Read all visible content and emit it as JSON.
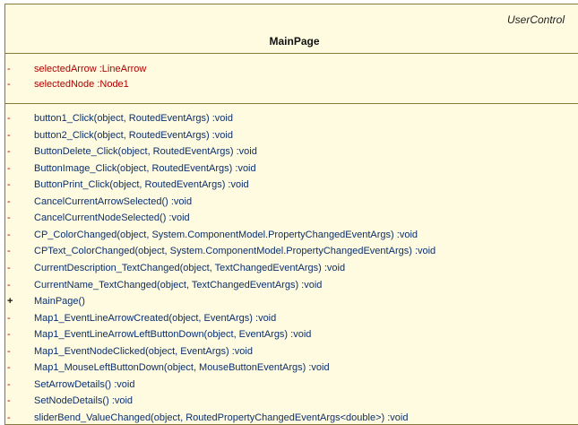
{
  "class": {
    "stereotype": "UserControl",
    "name": "MainPage"
  },
  "attributes": [
    {
      "visibility": "-",
      "text": "selectedArrow :LineArrow"
    },
    {
      "visibility": "-",
      "text": "selectedNode :Node1"
    }
  ],
  "methods": [
    {
      "visibility": "-",
      "text": "button1_Click(object, RoutedEventArgs) :void"
    },
    {
      "visibility": "-",
      "text": "button2_Click(object, RoutedEventArgs) :void"
    },
    {
      "visibility": "-",
      "text": "ButtonDelete_Click(object, RoutedEventArgs) :void"
    },
    {
      "visibility": "-",
      "text": "ButtonImage_Click(object, RoutedEventArgs) :void"
    },
    {
      "visibility": "-",
      "text": "ButtonPrint_Click(object, RoutedEventArgs) :void"
    },
    {
      "visibility": "-",
      "text": "CancelCurrentArrowSelected() :void"
    },
    {
      "visibility": "-",
      "text": "CancelCurrentNodeSelected() :void"
    },
    {
      "visibility": "-",
      "text": "CP_ColorChanged(object, System.ComponentModel.PropertyChangedEventArgs) :void"
    },
    {
      "visibility": "-",
      "text": "CPText_ColorChanged(object, System.ComponentModel.PropertyChangedEventArgs) :void"
    },
    {
      "visibility": "-",
      "text": "CurrentDescription_TextChanged(object, TextChangedEventArgs) :void"
    },
    {
      "visibility": "-",
      "text": "CurrentName_TextChanged(object, TextChangedEventArgs) :void"
    },
    {
      "visibility": "+",
      "text": "MainPage()"
    },
    {
      "visibility": "-",
      "text": "Map1_EventLineArrowCreated(object, EventArgs) :void"
    },
    {
      "visibility": "-",
      "text": "Map1_EventLineArrowLeftButtonDown(object, EventArgs) :void"
    },
    {
      "visibility": "-",
      "text": "Map1_EventNodeClicked(object, EventArgs) :void"
    },
    {
      "visibility": "-",
      "text": "Map1_MouseLeftButtonDown(object, MouseButtonEventArgs) :void"
    },
    {
      "visibility": "-",
      "text": "SetArrowDetails() :void"
    },
    {
      "visibility": "-",
      "text": "SetNodeDetails() :void"
    },
    {
      "visibility": "-",
      "text": "sliderBend_ValueChanged(object, RoutedPropertyChangedEventArgs<double>) :void"
    }
  ]
}
